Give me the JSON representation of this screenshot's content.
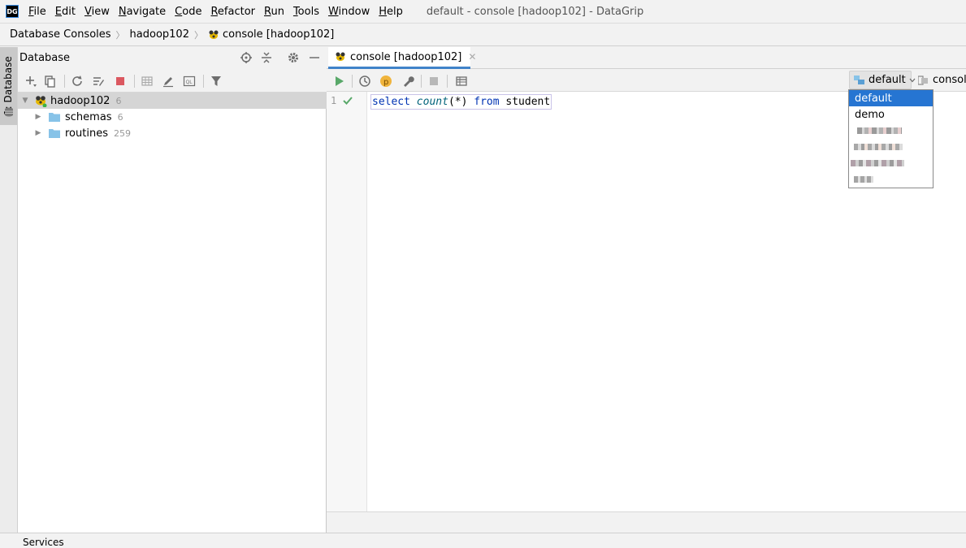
{
  "menubar": {
    "app_icon": "DG",
    "items": [
      {
        "mnemonic": "F",
        "rest": "ile"
      },
      {
        "mnemonic": "E",
        "rest": "dit"
      },
      {
        "mnemonic": "V",
        "rest": "iew"
      },
      {
        "mnemonic": "N",
        "rest": "avigate"
      },
      {
        "mnemonic": "C",
        "rest": "ode"
      },
      {
        "mnemonic": "R",
        "rest": "efactor"
      },
      {
        "mnemonic": "R",
        "rest": "un"
      },
      {
        "mnemonic": "T",
        "rest": "ools"
      },
      {
        "mnemonic": "W",
        "rest": "indow"
      },
      {
        "mnemonic": "H",
        "rest": "elp"
      }
    ],
    "window_title": "default - console [hadoop102] - DataGrip"
  },
  "breadcrumb": {
    "items": [
      "Database Consoles",
      "hadoop102",
      "console [hadoop102]"
    ]
  },
  "left_strip": {
    "label": "1: Database"
  },
  "db_panel": {
    "title": "Database",
    "tree": [
      {
        "label": "hadoop102",
        "count": "6",
        "expanded": true,
        "icon": "hive-datasource-icon"
      },
      {
        "label": "schemas",
        "count": "6",
        "expanded": false,
        "icon": "folder-icon"
      },
      {
        "label": "routines",
        "count": "259",
        "expanded": false,
        "icon": "folder-icon"
      }
    ]
  },
  "editor": {
    "tab_label": "console [hadoop102]",
    "line_number": "1",
    "code": {
      "kw1": "select",
      "fn": "count",
      "args": "(*)",
      "kw2": "from",
      "table": "student"
    }
  },
  "schema_selector": {
    "selected": "default",
    "session_label": "console",
    "options": [
      "default",
      "demo"
    ]
  },
  "services": {
    "label": "Services"
  },
  "colors": {
    "accent": "#2675d2",
    "run_green": "#59a869",
    "stop_red": "#db5860",
    "folder_blue": "#87c3e8",
    "keyword": "#0033b3"
  }
}
